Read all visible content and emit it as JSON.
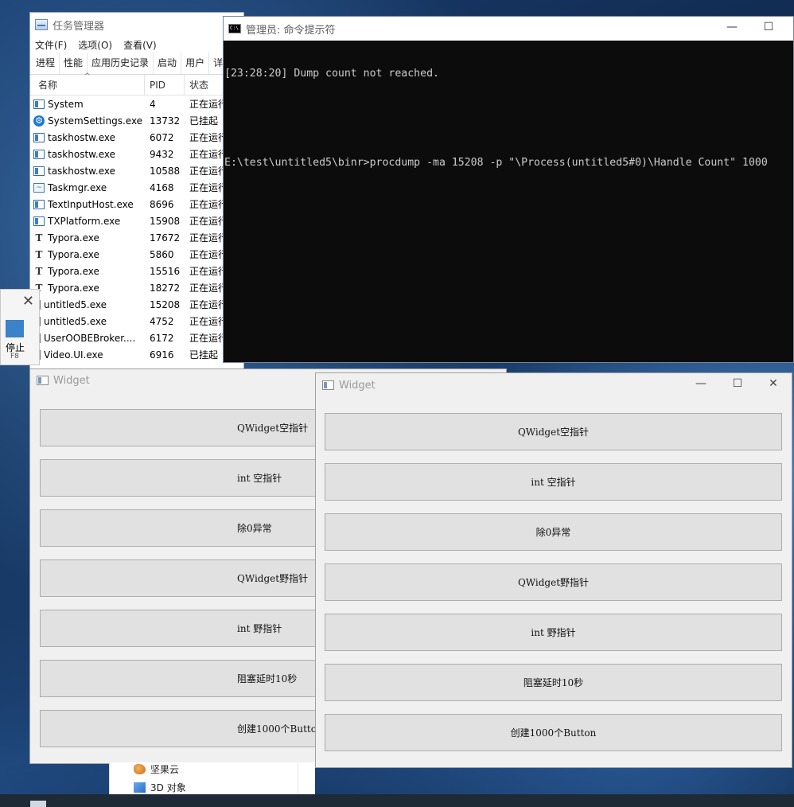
{
  "taskmgr": {
    "title": "任务管理器",
    "menu": [
      "文件(F)",
      "选项(O)",
      "查看(V)"
    ],
    "tabs": [
      "进程",
      "性能",
      "应用历史记录",
      "启动",
      "用户",
      "详"
    ],
    "columns": {
      "name": "名称",
      "pid": "PID",
      "status": "状态"
    },
    "rows": [
      {
        "icon": "win-icon",
        "name": "System",
        "pid": "4",
        "status": "正在运行"
      },
      {
        "icon": "gear-icon",
        "name": "SystemSettings.exe",
        "pid": "13732",
        "status": "已挂起"
      },
      {
        "icon": "win-icon",
        "name": "taskhostw.exe",
        "pid": "6072",
        "status": "正在运行"
      },
      {
        "icon": "win-icon",
        "name": "taskhostw.exe",
        "pid": "9432",
        "status": "正在运行"
      },
      {
        "icon": "win-icon",
        "name": "taskhostw.exe",
        "pid": "10588",
        "status": "正在运行"
      },
      {
        "icon": "chart-icon",
        "name": "Taskmgr.exe",
        "pid": "4168",
        "status": "正在运行"
      },
      {
        "icon": "win-icon",
        "name": "TextInputHost.exe",
        "pid": "8696",
        "status": "正在运行"
      },
      {
        "icon": "win-icon",
        "name": "TXPlatform.exe",
        "pid": "15908",
        "status": "正在运行"
      },
      {
        "icon": "typora-icon",
        "name": "Typora.exe",
        "pid": "17672",
        "status": "正在运行"
      },
      {
        "icon": "typora-icon",
        "name": "Typora.exe",
        "pid": "5860",
        "status": "正在运行"
      },
      {
        "icon": "typora-icon",
        "name": "Typora.exe",
        "pid": "15516",
        "status": "正在运行"
      },
      {
        "icon": "typora-icon",
        "name": "Typora.exe",
        "pid": "18272",
        "status": "正在运行"
      },
      {
        "icon": "doc-icon",
        "name": "untitled5.exe",
        "pid": "15208",
        "status": "正在运行"
      },
      {
        "icon": "doc-icon",
        "name": "untitled5.exe",
        "pid": "4752",
        "status": "正在运行"
      },
      {
        "icon": "doc-icon",
        "name": "UserOOBEBroker....",
        "pid": "6172",
        "status": "正在运行"
      },
      {
        "icon": "doc-icon",
        "name": "Video.UI.exe",
        "pid": "6916",
        "status": "已挂起"
      }
    ]
  },
  "stop_popup": {
    "label": "停止",
    "key": "F8"
  },
  "cmd": {
    "title": "管理员: 命令提示符",
    "lines": [
      "[23:28:20] Dump count not reached.",
      "",
      "E:\\test\\untitled5\\binr>procdump -ma 15208 -p \"\\Process(untitled5#0)\\Handle Count\" 1000"
    ]
  },
  "widget_left": {
    "title": "Widget",
    "buttons": [
      "QWidget空指针",
      "int 空指针",
      "除0异常",
      "QWidget野指针",
      "int 野指针",
      "阻塞延时10秒",
      "创建1000个Button"
    ]
  },
  "widget_right": {
    "title": "Widget",
    "buttons": [
      "QWidget空指针",
      "int 空指针",
      "除0异常",
      "QWidget野指针",
      "int 野指针",
      "阻塞延时10秒",
      "创建1000个Button"
    ]
  },
  "explorer": {
    "items": [
      "坚果云",
      "3D 对象"
    ]
  }
}
